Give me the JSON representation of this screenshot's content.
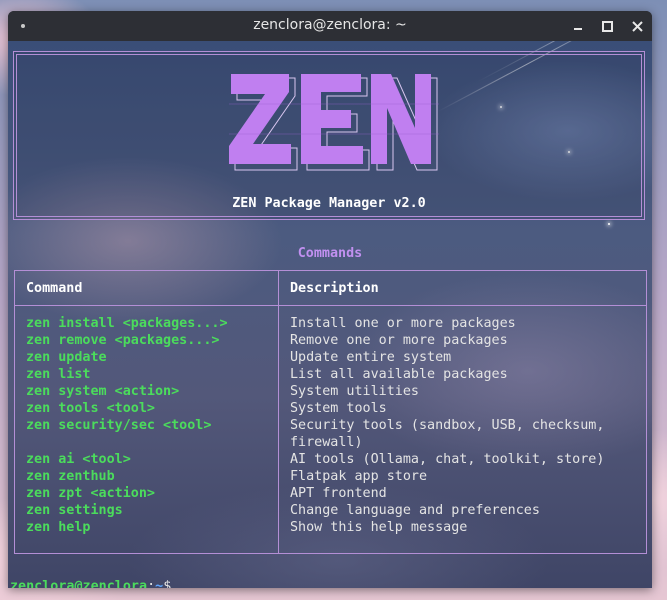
{
  "window": {
    "title": "zenclora@zenclora: ~"
  },
  "banner": {
    "logo_text": "ZEN",
    "subtitle": "ZEN Package Manager v2.0"
  },
  "section": {
    "title": "Commands"
  },
  "table": {
    "headers": {
      "command": "Command",
      "description": "Description"
    },
    "rows": [
      {
        "command": "zen install <packages...>",
        "description": "Install one or more packages"
      },
      {
        "command": "zen remove <packages...>",
        "description": "Remove one or more packages"
      },
      {
        "command": "zen update",
        "description": "Update entire system"
      },
      {
        "command": "zen list",
        "description": "List all available packages"
      },
      {
        "command": "zen system <action>",
        "description": "System utilities"
      },
      {
        "command": "zen tools <tool>",
        "description": "System tools"
      },
      {
        "command": "zen security/sec <tool>",
        "description": "Security tools (sandbox, USB, checksum,\nfirewall)"
      },
      {
        "command": "zen ai <tool>",
        "description": "AI tools (Ollama, chat, toolkit, store)"
      },
      {
        "command": "zen zenthub",
        "description": "Flatpak app store"
      },
      {
        "command": "zen zpt <action>",
        "description": "APT frontend"
      },
      {
        "command": "zen settings",
        "description": "Change language and preferences"
      },
      {
        "command": "zen help",
        "description": "Show this help message"
      }
    ]
  },
  "prompt": {
    "user_host": "zenclora@zenclora",
    "separator": ":",
    "path": "~",
    "symbol": "$"
  },
  "colors": {
    "accent": "#b48fd6",
    "logo": "#c07ff0",
    "command": "#4bdc5c",
    "path": "#5fa6ff"
  },
  "icons": {
    "window_menu": "dot-icon",
    "minimize": "minimize-icon",
    "maximize": "maximize-icon",
    "close": "close-icon"
  }
}
